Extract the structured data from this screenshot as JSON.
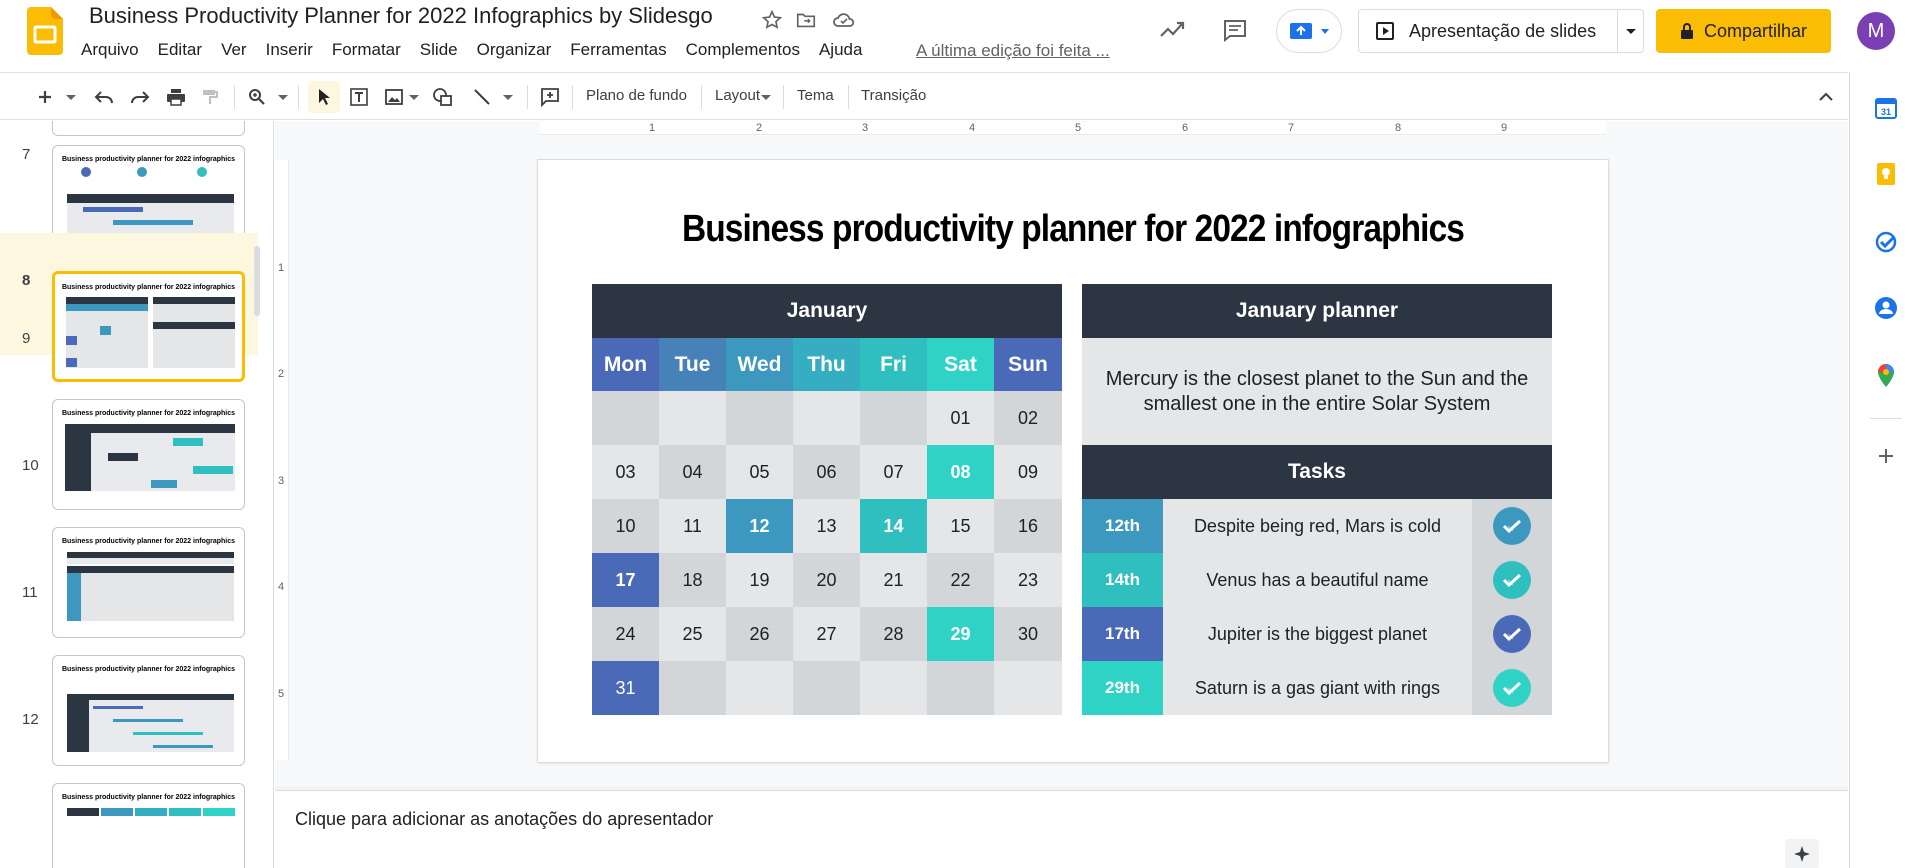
{
  "header": {
    "doc_title": "Business Productivity Planner for 2022 Infographics by Slidesgo",
    "menu": [
      "Arquivo",
      "Editar",
      "Ver",
      "Inserir",
      "Formatar",
      "Slide",
      "Organizar",
      "Ferramentas",
      "Complementos",
      "Ajuda"
    ],
    "last_edit": "A última edição foi feita ...",
    "present_label": "Apresentação de slides",
    "share_label": "Compartilhar",
    "avatar_letter": "M"
  },
  "toolbar": {
    "background": "Plano de fundo",
    "layout": "Layout",
    "theme": "Tema",
    "transition": "Transição"
  },
  "ruler": {
    "h": [
      "1",
      "2",
      "3",
      "4",
      "5",
      "6",
      "7",
      "8",
      "9"
    ],
    "v": [
      "1",
      "2",
      "3",
      "4",
      "5"
    ]
  },
  "filmstrip": {
    "numbers": [
      "7",
      "8",
      "9",
      "10",
      "11",
      "12"
    ],
    "thumb_title": "Business productivity planner for 2022 infographics",
    "selected": "8"
  },
  "slide": {
    "title": "Business productivity planner for 2022 infographics",
    "calendar": {
      "month": "January",
      "days": [
        "Mon",
        "Tue",
        "Wed",
        "Thu",
        "Fri",
        "Sat",
        "Sun"
      ],
      "day_colors": [
        "#4a6ab8",
        "#4681b8",
        "#3d98bf",
        "#35aec1",
        "#2fbfbf",
        "#2ed3c6",
        "#4a6ab8"
      ],
      "weeks": [
        [
          "",
          "",
          "",
          "",
          "",
          "01",
          "02"
        ],
        [
          "03",
          "04",
          "05",
          "06",
          "07",
          "08",
          "09"
        ],
        [
          "10",
          "11",
          "12",
          "13",
          "14",
          "15",
          "16"
        ],
        [
          "17",
          "18",
          "19",
          "20",
          "21",
          "22",
          "23"
        ],
        [
          "24",
          "25",
          "26",
          "27",
          "28",
          "29",
          "30"
        ],
        [
          "31",
          "",
          "",
          "",
          "",
          "",
          ""
        ]
      ],
      "highlights": {
        "08": "#2ed3c6",
        "12": "#3d98bf",
        "14": "#2fbfbf",
        "17": "#4a6ab8",
        "29": "#2ed3c6",
        "31": "#4a6ab8"
      }
    },
    "planner": {
      "title": "January planner",
      "description": "Mercury is the closest planet to the Sun and the smallest one in the entire Solar System",
      "tasks_title": "Tasks",
      "tasks": [
        {
          "date": "12th",
          "text": "Despite being red, Mars is cold",
          "color": "#3d98bf"
        },
        {
          "date": "14th",
          "text": "Venus has a beautiful name",
          "color": "#2fbfbf"
        },
        {
          "date": "17th",
          "text": "Jupiter is the biggest planet",
          "color": "#4a6ab8"
        },
        {
          "date": "29th",
          "text": "Saturn is a gas giant with rings",
          "color": "#2ed3c6"
        }
      ]
    }
  },
  "notes": {
    "placeholder": "Clique para adicionar as anotações do apresentador"
  },
  "colors": {
    "dark_header": "#2c3643",
    "share_yellow": "#fbbc04",
    "avatar_purple": "#7b3fb4"
  }
}
